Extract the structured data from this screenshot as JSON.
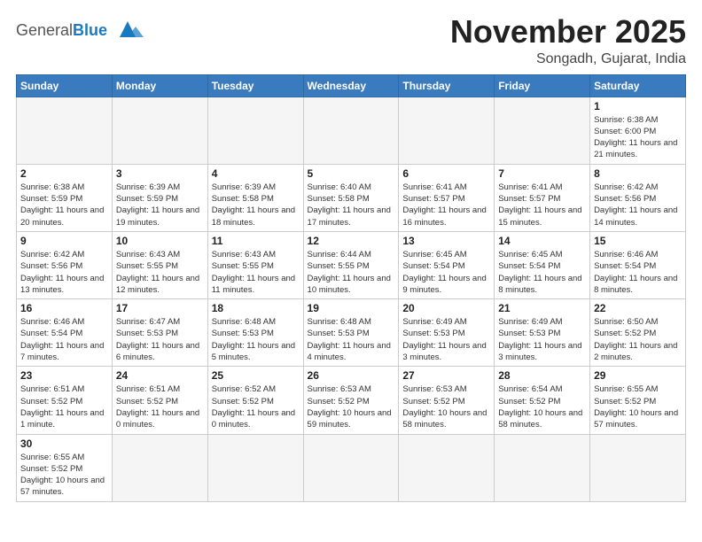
{
  "header": {
    "logo_general": "General",
    "logo_blue": "Blue",
    "month_title": "November 2025",
    "location": "Songadh, Gujarat, India"
  },
  "weekdays": [
    "Sunday",
    "Monday",
    "Tuesday",
    "Wednesday",
    "Thursday",
    "Friday",
    "Saturday"
  ],
  "weeks": [
    [
      {
        "day": "",
        "empty": true
      },
      {
        "day": "",
        "empty": true
      },
      {
        "day": "",
        "empty": true
      },
      {
        "day": "",
        "empty": true
      },
      {
        "day": "",
        "empty": true
      },
      {
        "day": "",
        "empty": true
      },
      {
        "day": "1",
        "sunrise": "6:38 AM",
        "sunset": "6:00 PM",
        "daylight": "11 hours and 21 minutes."
      }
    ],
    [
      {
        "day": "2",
        "sunrise": "6:38 AM",
        "sunset": "5:59 PM",
        "daylight": "11 hours and 20 minutes."
      },
      {
        "day": "3",
        "sunrise": "6:39 AM",
        "sunset": "5:59 PM",
        "daylight": "11 hours and 19 minutes."
      },
      {
        "day": "4",
        "sunrise": "6:39 AM",
        "sunset": "5:58 PM",
        "daylight": "11 hours and 18 minutes."
      },
      {
        "day": "5",
        "sunrise": "6:40 AM",
        "sunset": "5:58 PM",
        "daylight": "11 hours and 17 minutes."
      },
      {
        "day": "6",
        "sunrise": "6:41 AM",
        "sunset": "5:57 PM",
        "daylight": "11 hours and 16 minutes."
      },
      {
        "day": "7",
        "sunrise": "6:41 AM",
        "sunset": "5:57 PM",
        "daylight": "11 hours and 15 minutes."
      },
      {
        "day": "8",
        "sunrise": "6:42 AM",
        "sunset": "5:56 PM",
        "daylight": "11 hours and 14 minutes."
      }
    ],
    [
      {
        "day": "9",
        "sunrise": "6:42 AM",
        "sunset": "5:56 PM",
        "daylight": "11 hours and 13 minutes."
      },
      {
        "day": "10",
        "sunrise": "6:43 AM",
        "sunset": "5:55 PM",
        "daylight": "11 hours and 12 minutes."
      },
      {
        "day": "11",
        "sunrise": "6:43 AM",
        "sunset": "5:55 PM",
        "daylight": "11 hours and 11 minutes."
      },
      {
        "day": "12",
        "sunrise": "6:44 AM",
        "sunset": "5:55 PM",
        "daylight": "11 hours and 10 minutes."
      },
      {
        "day": "13",
        "sunrise": "6:45 AM",
        "sunset": "5:54 PM",
        "daylight": "11 hours and 9 minutes."
      },
      {
        "day": "14",
        "sunrise": "6:45 AM",
        "sunset": "5:54 PM",
        "daylight": "11 hours and 8 minutes."
      },
      {
        "day": "15",
        "sunrise": "6:46 AM",
        "sunset": "5:54 PM",
        "daylight": "11 hours and 8 minutes."
      }
    ],
    [
      {
        "day": "16",
        "sunrise": "6:46 AM",
        "sunset": "5:54 PM",
        "daylight": "11 hours and 7 minutes."
      },
      {
        "day": "17",
        "sunrise": "6:47 AM",
        "sunset": "5:53 PM",
        "daylight": "11 hours and 6 minutes."
      },
      {
        "day": "18",
        "sunrise": "6:48 AM",
        "sunset": "5:53 PM",
        "daylight": "11 hours and 5 minutes."
      },
      {
        "day": "19",
        "sunrise": "6:48 AM",
        "sunset": "5:53 PM",
        "daylight": "11 hours and 4 minutes."
      },
      {
        "day": "20",
        "sunrise": "6:49 AM",
        "sunset": "5:53 PM",
        "daylight": "11 hours and 3 minutes."
      },
      {
        "day": "21",
        "sunrise": "6:49 AM",
        "sunset": "5:53 PM",
        "daylight": "11 hours and 3 minutes."
      },
      {
        "day": "22",
        "sunrise": "6:50 AM",
        "sunset": "5:52 PM",
        "daylight": "11 hours and 2 minutes."
      }
    ],
    [
      {
        "day": "23",
        "sunrise": "6:51 AM",
        "sunset": "5:52 PM",
        "daylight": "11 hours and 1 minute."
      },
      {
        "day": "24",
        "sunrise": "6:51 AM",
        "sunset": "5:52 PM",
        "daylight": "11 hours and 0 minutes."
      },
      {
        "day": "25",
        "sunrise": "6:52 AM",
        "sunset": "5:52 PM",
        "daylight": "11 hours and 0 minutes."
      },
      {
        "day": "26",
        "sunrise": "6:53 AM",
        "sunset": "5:52 PM",
        "daylight": "10 hours and 59 minutes."
      },
      {
        "day": "27",
        "sunrise": "6:53 AM",
        "sunset": "5:52 PM",
        "daylight": "10 hours and 58 minutes."
      },
      {
        "day": "28",
        "sunrise": "6:54 AM",
        "sunset": "5:52 PM",
        "daylight": "10 hours and 58 minutes."
      },
      {
        "day": "29",
        "sunrise": "6:55 AM",
        "sunset": "5:52 PM",
        "daylight": "10 hours and 57 minutes."
      }
    ],
    [
      {
        "day": "30",
        "sunrise": "6:55 AM",
        "sunset": "5:52 PM",
        "daylight": "10 hours and 57 minutes."
      },
      {
        "day": "",
        "empty": true
      },
      {
        "day": "",
        "empty": true
      },
      {
        "day": "",
        "empty": true
      },
      {
        "day": "",
        "empty": true
      },
      {
        "day": "",
        "empty": true
      },
      {
        "day": "",
        "empty": true
      }
    ]
  ],
  "labels": {
    "sunrise": "Sunrise:",
    "sunset": "Sunset:",
    "daylight": "Daylight:"
  }
}
